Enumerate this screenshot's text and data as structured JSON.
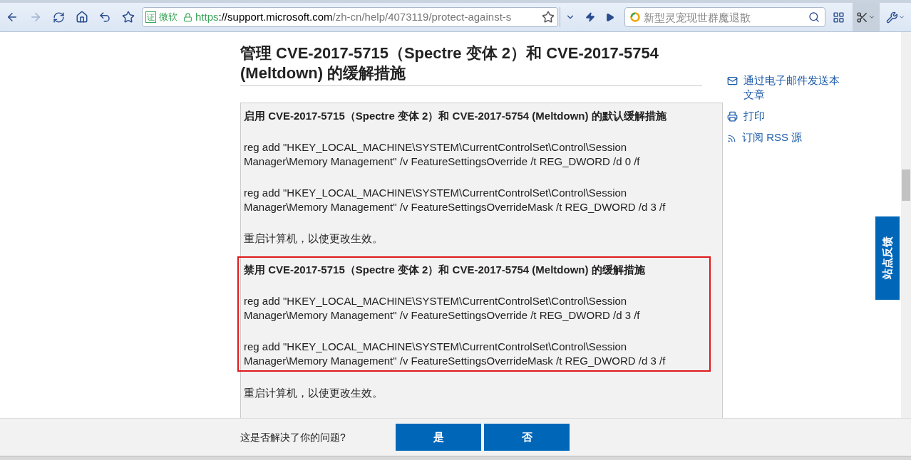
{
  "toolbar": {
    "address": {
      "badge": "证",
      "owner": "微软",
      "scheme": "https",
      "host": "://support.microsoft.com",
      "path": "/zh-cn/help/4073119/protect-against-s"
    },
    "search": {
      "placeholder": "新型灵宠现世群魔退散"
    }
  },
  "article": {
    "title": "管理 CVE-2017-5715（Spectre 变体 2）和 CVE-2017-5754 (Meltdown) 的缓解措施",
    "sections": [
      {
        "highlighted": false,
        "heading": "启用 CVE-2017-5715（Spectre 变体 2）和 CVE-2017-5754 (Meltdown) 的默认缓解措施",
        "commands": [
          "reg add \"HKEY_LOCAL_MACHINE\\SYSTEM\\CurrentControlSet\\Control\\Session Manager\\Memory Management\" /v FeatureSettingsOverride /t REG_DWORD /d 0 /f",
          "reg add \"HKEY_LOCAL_MACHINE\\SYSTEM\\CurrentControlSet\\Control\\Session Manager\\Memory Management\" /v FeatureSettingsOverrideMask /t REG_DWORD /d 3 /f"
        ],
        "note": "重启计算机，以使更改生效。"
      },
      {
        "highlighted": true,
        "heading": "禁用 CVE-2017-5715（Spectre 变体 2）和 CVE-2017-5754 (Meltdown) 的缓解措施",
        "commands": [
          "reg add \"HKEY_LOCAL_MACHINE\\SYSTEM\\CurrentControlSet\\Control\\Session Manager\\Memory Management\" /v FeatureSettingsOverride /t REG_DWORD /d 3 /f",
          "reg add \"HKEY_LOCAL_MACHINE\\SYSTEM\\CurrentControlSet\\Control\\Session Manager\\Memory Management\" /v FeatureSettingsOverrideMask /t REG_DWORD /d 3 /f"
        ],
        "note": "重启计算机，以使更改生效。"
      }
    ]
  },
  "sidebar": {
    "links": [
      {
        "kind": "email",
        "label": "通过电子邮件发送本文章"
      },
      {
        "kind": "print",
        "label": "打印"
      },
      {
        "kind": "rss",
        "label": "订阅 RSS 源"
      }
    ]
  },
  "feedback_tab": "站点反馈",
  "feedback": {
    "question": "这是否解决了你的问题?",
    "buttons": [
      "是",
      "否"
    ]
  }
}
